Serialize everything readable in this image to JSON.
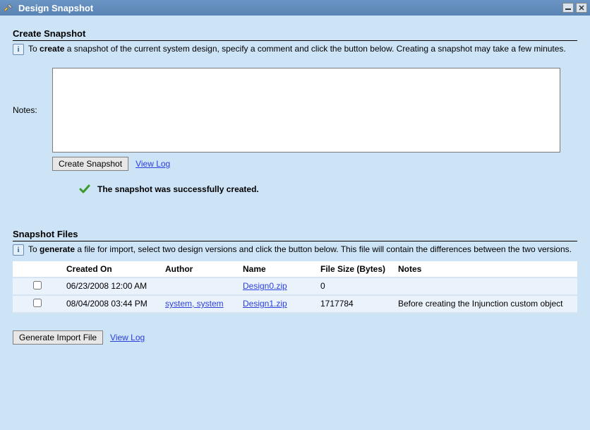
{
  "window": {
    "title": "Design Snapshot"
  },
  "create_section": {
    "heading": "Create Snapshot",
    "info_pre": "To ",
    "info_bold": "create",
    "info_post": " a snapshot of the current system design, specify a comment and click the button below. Creating a snapshot may take a few minutes.",
    "notes_label": "Notes:",
    "notes_value": "",
    "create_btn": "Create Snapshot",
    "view_log": "View Log",
    "success_msg": "The snapshot was successfully created."
  },
  "files_section": {
    "heading": "Snapshot Files",
    "info_pre": "To ",
    "info_bold": "generate",
    "info_post": " a file for import, select two design versions and click the button below. This file will contain the differences between the two versions.",
    "columns": {
      "created": "Created On",
      "author": "Author",
      "name": "Name",
      "size": "File Size (Bytes)",
      "notes": "Notes"
    },
    "rows": [
      {
        "created": "06/23/2008 12:00 AM",
        "author": "",
        "name": "Design0.zip",
        "size": "0",
        "notes": ""
      },
      {
        "created": "08/04/2008 03:44 PM",
        "author": "system, system",
        "name": "Design1.zip",
        "size": "1717784",
        "notes": "Before creating the Injunction custom object"
      }
    ],
    "generate_btn": "Generate Import File",
    "view_log": "View Log"
  }
}
